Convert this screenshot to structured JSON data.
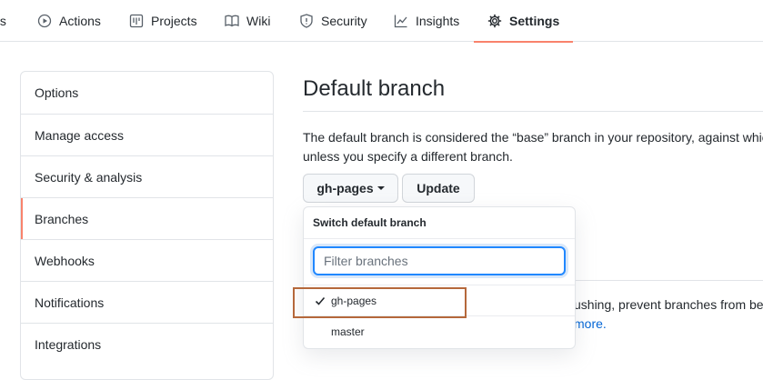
{
  "nav": {
    "tabs": [
      {
        "label": "ts",
        "icon": "code-icon"
      },
      {
        "label": "Actions",
        "icon": "play-icon"
      },
      {
        "label": "Projects",
        "icon": "project-icon"
      },
      {
        "label": "Wiki",
        "icon": "book-icon"
      },
      {
        "label": "Security",
        "icon": "shield-icon"
      },
      {
        "label": "Insights",
        "icon": "graph-icon"
      },
      {
        "label": "Settings",
        "icon": "gear-icon",
        "selected": true
      }
    ]
  },
  "sidebar": {
    "items": [
      {
        "label": "Options"
      },
      {
        "label": "Manage access"
      },
      {
        "label": "Security & analysis"
      },
      {
        "label": "Branches",
        "selected": true
      },
      {
        "label": "Webhooks"
      },
      {
        "label": "Notifications"
      },
      {
        "label": "Integrations"
      }
    ]
  },
  "main": {
    "title": "Default branch",
    "description_line1": "The default branch is considered the “base” branch in your repository, against which",
    "description_line2": "unless you specify a different branch.",
    "branch_button_label": "gh-pages",
    "update_button_label": "Update",
    "behind_text_line1": "ushing, prevent branches from be",
    "behind_link_text": "more."
  },
  "branch_popover": {
    "header": "Switch default branch",
    "filter_placeholder": "Filter branches",
    "filter_value": "",
    "items": [
      {
        "label": "gh-pages",
        "checked": true
      },
      {
        "label": "master",
        "checked": false
      }
    ]
  },
  "colors": {
    "accent_underline": "#f9826c",
    "link": "#0366d6",
    "focus_ring": "#2188ff",
    "annotation_box": "#b5683b"
  }
}
